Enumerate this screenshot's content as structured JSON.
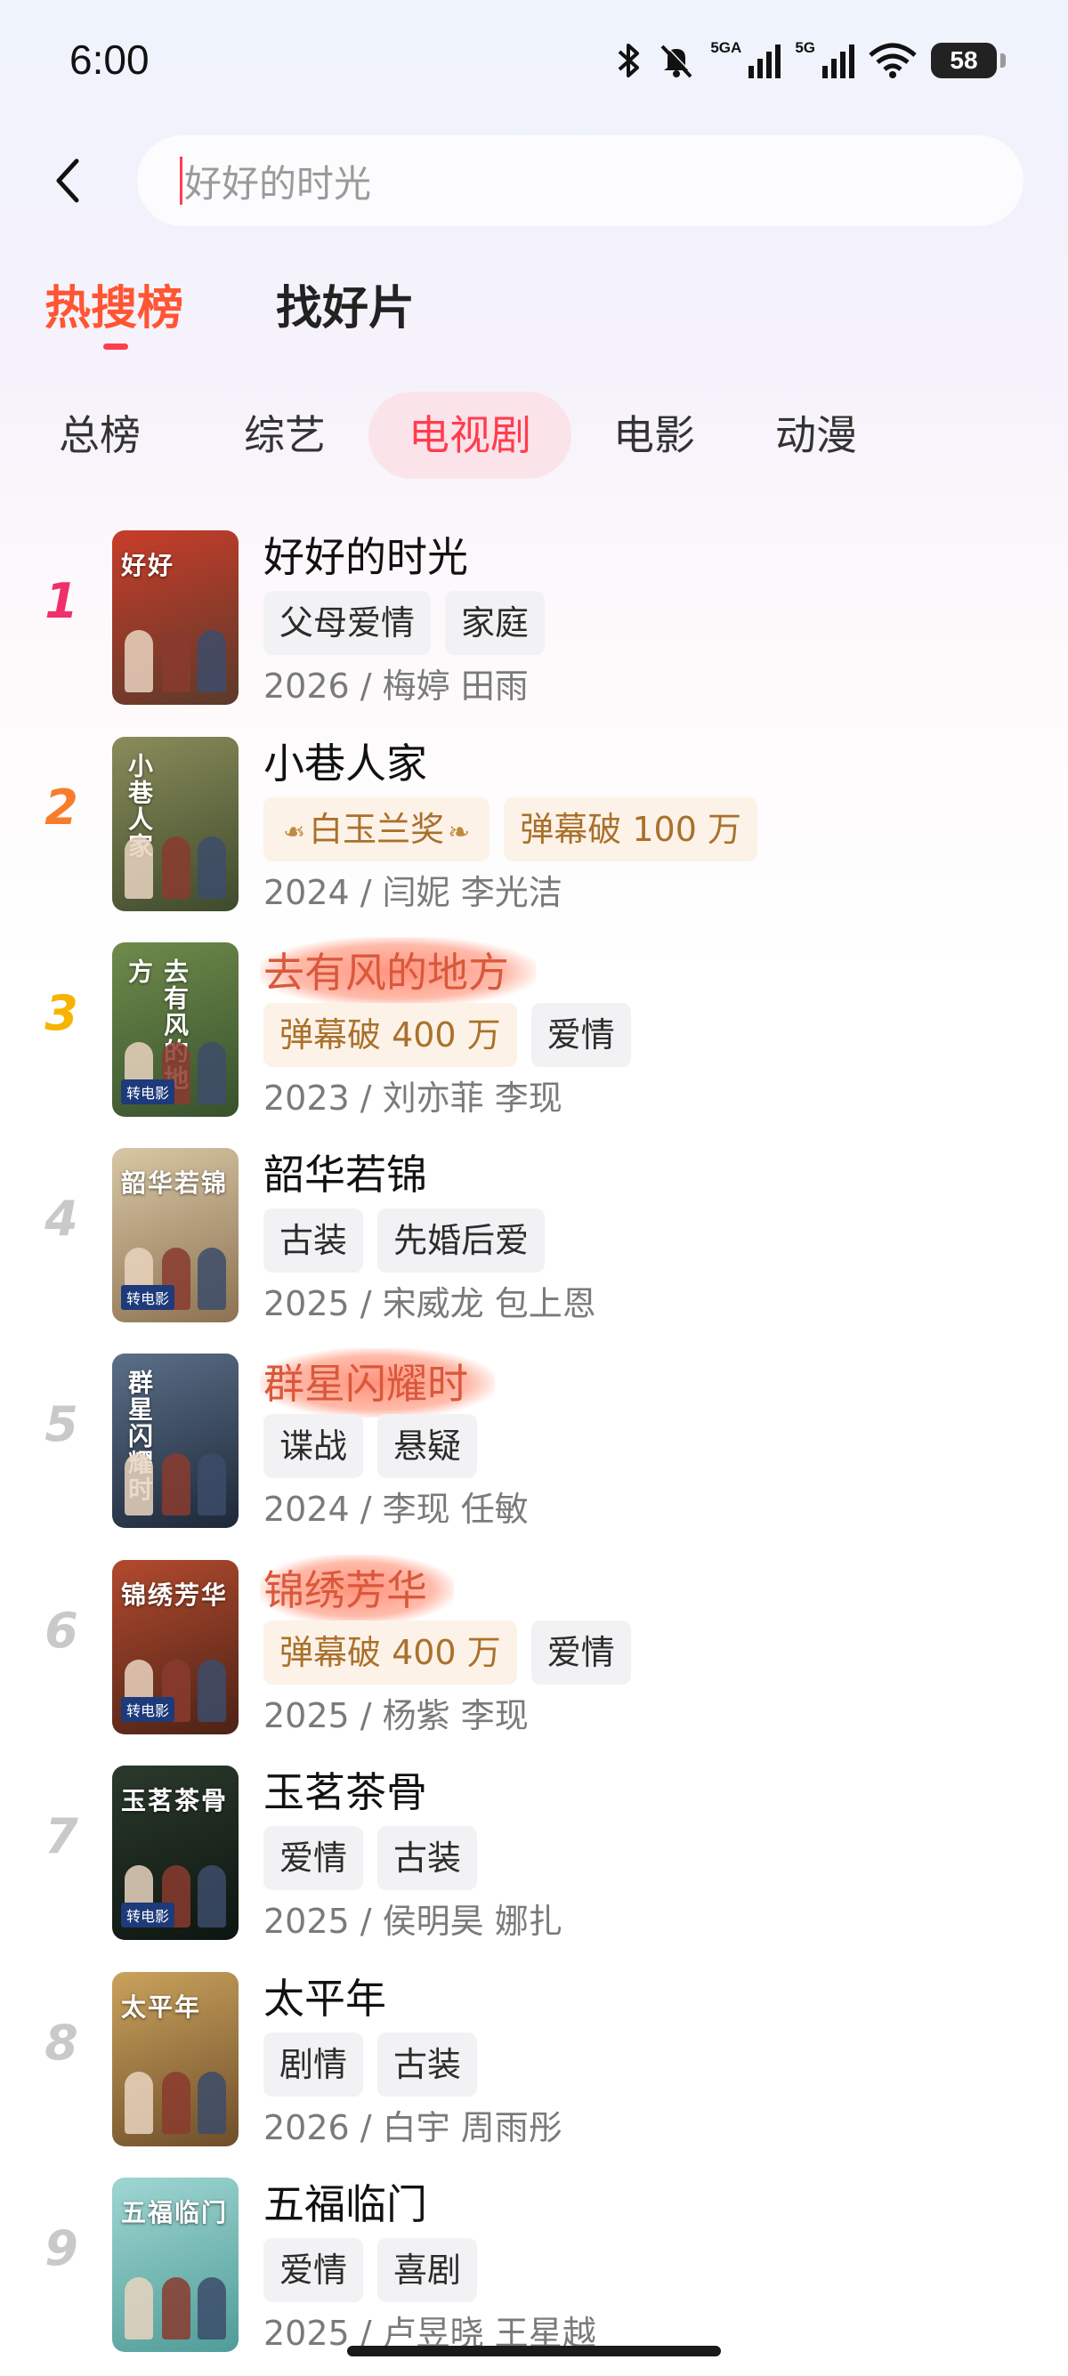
{
  "status_bar": {
    "time": "6:00",
    "icons": [
      "bluetooth-icon",
      "mute-icon",
      "signal-5ga-icon",
      "signal-5g-icon",
      "wifi-icon"
    ],
    "net1": "5GA",
    "net2": "5G",
    "battery": "58"
  },
  "search": {
    "back_icon": "chevron-left-icon",
    "placeholder": "好好的时光"
  },
  "main_tabs": [
    {
      "label": "热搜榜",
      "active": true
    },
    {
      "label": "找好片",
      "active": false
    }
  ],
  "category_tabs": [
    {
      "label": "总榜",
      "active": false
    },
    {
      "label": "综艺",
      "active": false
    },
    {
      "label": "电视剧",
      "active": true
    },
    {
      "label": "电影",
      "active": false
    },
    {
      "label": "动漫",
      "active": false
    }
  ],
  "colors": {
    "accent": "#ff3d4e",
    "rank1": "#f0306a",
    "rank2": "#f77d2d",
    "rank3": "#f6b400",
    "rank_other": "#c9c9c9",
    "gold_tag_bg": "#fdf2e8",
    "gold_tag_text": "#a9712b"
  },
  "items": [
    {
      "rank": "1",
      "title": "好好的时光",
      "highlight": false,
      "tags": [
        {
          "text": "父母爱情",
          "style": "plain"
        },
        {
          "text": "家庭",
          "style": "plain"
        }
      ],
      "meta": "2026 / 梅婷 田雨"
    },
    {
      "rank": "2",
      "title": "小巷人家",
      "highlight": false,
      "tags": [
        {
          "text": "白玉兰奖",
          "style": "award"
        },
        {
          "text": "弹幕破 100 万",
          "style": "gold"
        }
      ],
      "meta": "2024 / 闫妮 李光洁"
    },
    {
      "rank": "3",
      "title": "去有风的地方",
      "highlight": true,
      "tags": [
        {
          "text": "弹幕破 400 万",
          "style": "gold"
        },
        {
          "text": "爱情",
          "style": "plain"
        }
      ],
      "meta": "2023 / 刘亦菲 李现"
    },
    {
      "rank": "4",
      "title": "韶华若锦",
      "highlight": false,
      "tags": [
        {
          "text": "古装",
          "style": "plain"
        },
        {
          "text": "先婚后爱",
          "style": "plain"
        }
      ],
      "meta": "2025 / 宋威龙 包上恩"
    },
    {
      "rank": "5",
      "title": "群星闪耀时",
      "highlight": true,
      "tags": [
        {
          "text": "谍战",
          "style": "plain"
        },
        {
          "text": "悬疑",
          "style": "plain"
        }
      ],
      "meta": "2024 / 李现 任敏"
    },
    {
      "rank": "6",
      "title": "锦绣芳华",
      "highlight": true,
      "tags": [
        {
          "text": "弹幕破 400 万",
          "style": "gold"
        },
        {
          "text": "爱情",
          "style": "plain"
        }
      ],
      "meta": "2025 / 杨紫 李现"
    },
    {
      "rank": "7",
      "title": "玉茗茶骨",
      "highlight": false,
      "tags": [
        {
          "text": "爱情",
          "style": "plain"
        },
        {
          "text": "古装",
          "style": "plain"
        }
      ],
      "meta": "2025 / 侯明昊 娜扎"
    },
    {
      "rank": "8",
      "title": "太平年",
      "highlight": false,
      "tags": [
        {
          "text": "剧情",
          "style": "plain"
        },
        {
          "text": "古装",
          "style": "plain"
        }
      ],
      "meta": "2026 / 白宇 周雨彤"
    },
    {
      "rank": "9",
      "title": "五福临门",
      "highlight": false,
      "tags": [
        {
          "text": "爱情",
          "style": "plain"
        },
        {
          "text": "喜剧",
          "style": "plain"
        }
      ],
      "meta": "2025 / 卢昱晓 王星越"
    }
  ],
  "posters": [
    {
      "overlay": "好好",
      "badge": "",
      "bg1": "#c93c2a",
      "bg2": "#5b3a2a"
    },
    {
      "overlay": "小巷人家",
      "badge": "",
      "bg1": "#8a8c5a",
      "bg2": "#3e4a2c"
    },
    {
      "overlay": "去有风的地方",
      "badge": "转电影",
      "bg1": "#6f8a4a",
      "bg2": "#37512d"
    },
    {
      "overlay": "韶华若锦",
      "badge": "转电影",
      "bg1": "#d8c7a4",
      "bg2": "#8c7252"
    },
    {
      "overlay": "群星闪耀时",
      "badge": "",
      "bg1": "#5b6f88",
      "bg2": "#1d2838"
    },
    {
      "overlay": "锦绣芳华",
      "badge": "转电影",
      "bg1": "#b24a2e",
      "bg2": "#4b2216"
    },
    {
      "overlay": "玉茗茶骨",
      "badge": "转电影",
      "bg1": "#2b3a2c",
      "bg2": "#0d1510"
    },
    {
      "overlay": "太平年",
      "badge": "",
      "bg1": "#caa25c",
      "bg2": "#6e4e2a"
    },
    {
      "overlay": "五福临门",
      "badge": "",
      "bg1": "#9fd6d2",
      "bg2": "#4f9c98"
    }
  ]
}
